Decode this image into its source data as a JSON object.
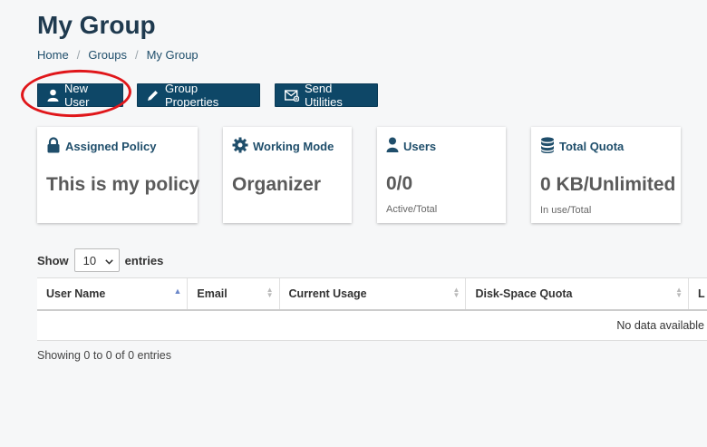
{
  "header": {
    "title": "My Group",
    "breadcrumb": [
      "Home",
      "Groups",
      "My Group"
    ]
  },
  "toolbar": {
    "new_user": "New User",
    "group_properties": "Group Properties",
    "send_utilities": "Send Utilities"
  },
  "cards": {
    "policy": {
      "title": "Assigned Policy",
      "value": "This is my policy"
    },
    "mode": {
      "title": "Working Mode",
      "value": "Organizer"
    },
    "users": {
      "title": "Users",
      "value": "0/0",
      "sub": "Active/Total"
    },
    "quota": {
      "title": "Total Quota",
      "value": "0 KB/Unlimited",
      "sub": "In use/Total"
    }
  },
  "table": {
    "show_label": "Show",
    "entries_label": "entries",
    "page_size": "10",
    "columns": [
      "User Name",
      "Email",
      "Current Usage",
      "Disk-Space Quota",
      "L"
    ],
    "empty_text": "No data available",
    "info": "Showing 0 to 0 of 0 entries"
  },
  "colors": {
    "accent": "#0e4767",
    "link": "#1f4e6b",
    "annotation": "#e0161a"
  }
}
